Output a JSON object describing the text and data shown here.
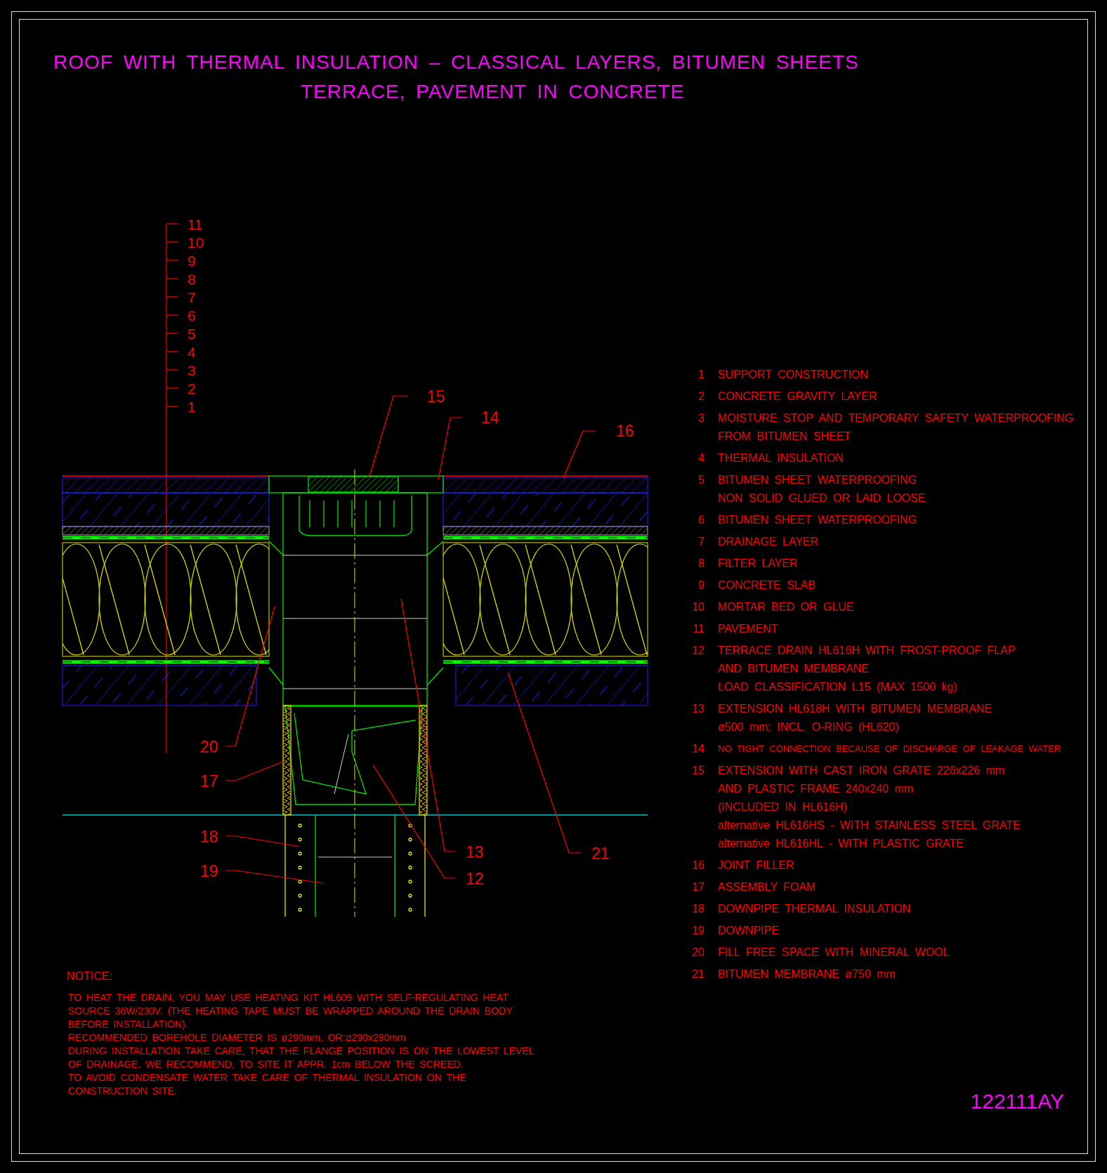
{
  "title": {
    "lines": [
      "ROOF WITH THERMAL INSULATION – CLASSICAL LAYERS, BITUMEN SHEETS",
      "TERRACE, PAVEMENT IN CONCRETE"
    ]
  },
  "drawing": {
    "level_scale": [
      "11",
      "10",
      "9",
      "8",
      "7",
      "6",
      "5",
      "4",
      "3",
      "2",
      "1"
    ],
    "callouts": [
      "15",
      "14",
      "16",
      "20",
      "17",
      "18",
      "19",
      "13",
      "12",
      "21"
    ]
  },
  "legend": [
    {
      "number": "1",
      "kind": "normal",
      "lines": [
        "SUPPORT CONSTRUCTION"
      ]
    },
    {
      "number": "2",
      "kind": "normal",
      "lines": [
        "CONCRETE GRAVITY LAYER"
      ]
    },
    {
      "number": "3",
      "kind": "normal",
      "lines": [
        "MOISTURE STOP AND TEMPORARY SAFETY WATERPROOFING",
        "FROM BITUMEN SHEET"
      ]
    },
    {
      "number": "4",
      "kind": "normal",
      "lines": [
        "THERMAL INSULATION"
      ]
    },
    {
      "number": "5",
      "kind": "normal",
      "lines": [
        "BITUMEN SHEET WATERPROOFING",
        "NON SOLID GLUED OR LAID LOOSE"
      ]
    },
    {
      "number": "6",
      "kind": "normal",
      "lines": [
        "BITUMEN SHEET WATERPROOFING"
      ]
    },
    {
      "number": "7",
      "kind": "normal",
      "lines": [
        "DRAINAGE LAYER"
      ]
    },
    {
      "number": "8",
      "kind": "normal",
      "lines": [
        "FILTER LAYER"
      ]
    },
    {
      "number": "9",
      "kind": "normal",
      "lines": [
        "CONCRETE SLAB"
      ]
    },
    {
      "number": "10",
      "kind": "normal",
      "lines": [
        "MORTAR BED OR GLUE"
      ]
    },
    {
      "number": "11",
      "kind": "normal",
      "lines": [
        "PAVEMENT"
      ]
    },
    {
      "number": "12",
      "kind": "normal",
      "lines": [
        "TERRACE DRAIN HL616H WITH FROST-PROOF FLAP",
        "AND BITUMEN MEMBRANE",
        "LOAD CLASSIFICATION L15 (MAX 1500 kg)"
      ]
    },
    {
      "number": "13",
      "kind": "normal",
      "lines": [
        "EXTENSION HL618H WITH BITUMEN MEMBRANE",
        "ø500 mm; INCL. O-RING (HL620)"
      ]
    },
    {
      "number": "14",
      "kind": "small",
      "lines": [
        "NO TIGHT CONNECTION BECAUSE OF DISCHARGE OF LEAKAGE WATER"
      ]
    },
    {
      "number": "15",
      "kind": "normal",
      "lines": [
        "EXTENSION WITH CAST IRON GRATE 226x226 mm",
        "AND PLASTIC FRAME 240x240 mm",
        "(INCLUDED IN HL616H)",
        "alternative HL616HS - WITH STAINLESS STEEL GRATE",
        "alternative HL616HL - WITH PLASTIC GRATE"
      ]
    },
    {
      "number": "16",
      "kind": "normal",
      "lines": [
        "JOINT FILLER"
      ]
    },
    {
      "number": "17",
      "kind": "normal",
      "lines": [
        "ASSEMBLY FOAM"
      ]
    },
    {
      "number": "18",
      "kind": "normal",
      "lines": [
        "DOWNPIPE THERMAL INSULATION"
      ]
    },
    {
      "number": "19",
      "kind": "normal",
      "lines": [
        "DOWNPIPE"
      ]
    },
    {
      "number": "20",
      "kind": "normal",
      "lines": [
        "FILL FREE SPACE WITH MINERAL WOOL"
      ]
    },
    {
      "number": "21",
      "kind": "normal",
      "lines": [
        "BITUMEN MEMBRANE ø750 mm"
      ]
    }
  ],
  "notice": {
    "heading": "NOTICE:",
    "lines": [
      "TO HEAT THE DRAIN, YOU MAY USE HEATING KIT HL609 WITH SELF-REGULATING HEAT",
      "SOURCE 36W/230V. (THE HEATING TAPE MUST BE WRAPPED AROUND THE DRAIN BODY",
      "BEFORE INSTALLATION).",
      "RECOMMENDED BOREHOLE DIAMETER IS ø290mm, OR:⧄290x290mm",
      "DURING INSTALLATION TAKE CARE, THAT THE FLANGE POSITION IS ON THE LOWEST LEVEL",
      "OF DRAINAGE. WE RECOMMEND, TO SITE IT APPR. 1cm BELOW THE SCREED.",
      "TO AVOID CONDENSATE WATER TAKE CARE OF THERMAL INSULATION ON THE",
      "CONSTRUCTION SITE."
    ]
  },
  "drawing_number": "122111AY"
}
